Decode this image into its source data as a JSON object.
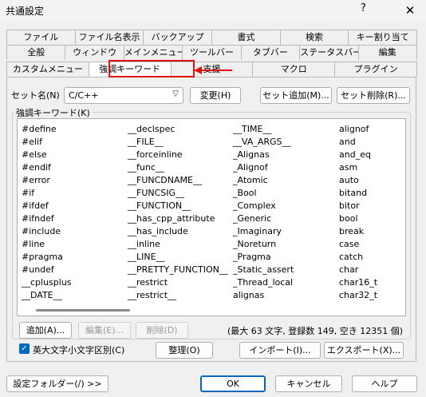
{
  "window": {
    "title": "共通設定",
    "help_glyph": "?",
    "close_glyph": "✕"
  },
  "tabs": {
    "row1": [
      "ファイル",
      "ファイル名表示",
      "バックアップ",
      "書式",
      "検索",
      "キー割り当て"
    ],
    "row2": [
      "全般",
      "ウィンドウ",
      "メインメニュー",
      "ツールバー",
      "タブバー",
      "ステータスバー",
      "編集"
    ],
    "row3": [
      "カスタムメニュー",
      "強調キーワード",
      "支援",
      "マクロ",
      "プラグイン"
    ],
    "active": "強調キーワード"
  },
  "set": {
    "label": "セット名(N)",
    "value": "C/C++",
    "change_button": "変更(H)",
    "add_button": "セット追加(M)...",
    "delete_button": "セット削除(R)..."
  },
  "keywords": {
    "group_title": "強調キーワード(K)",
    "columns": [
      [
        "#define",
        "#elif",
        "#else",
        "#endif",
        "#error",
        "#if",
        "#ifdef",
        "#ifndef",
        "#include",
        "#line",
        "#pragma",
        "#undef",
        "__cplusplus",
        "__DATE__"
      ],
      [
        "__declspec",
        "__FILE__",
        "__forceinline",
        "__func__",
        "__FUNCDNAME__",
        "__FUNCSIG__",
        "__FUNCTION__",
        "__has_cpp_attribute",
        "__has_include",
        "__inline",
        "__LINE__",
        "__PRETTY_FUNCTION__",
        "__restrict",
        "__restrict__"
      ],
      [
        "__TIME__",
        "__VA_ARGS__",
        "_Alignas",
        "_Alignof",
        "_Atomic",
        "_Bool",
        "_Complex",
        "_Generic",
        "_Imaginary",
        "_Noreturn",
        "_Pragma",
        "_Static_assert",
        "_Thread_local",
        "alignas"
      ],
      [
        "alignof",
        "and",
        "and_eq",
        "asm",
        "auto",
        "bitand",
        "bitor",
        "bool",
        "break",
        "case",
        "catch",
        "char",
        "char16_t",
        "char32_t"
      ]
    ],
    "add_button": "追加(A)...",
    "edit_button": "編集(E)...",
    "delete_button": "削除(D)",
    "stats": "(最大 63 文字, 登録数 149, 空き 12351 個)"
  },
  "options": {
    "case_checkbox_label": "英大文字小文字区別(C)",
    "case_checked": true,
    "organize_button": "整理(O)",
    "import_button": "インポート(I)...",
    "export_button": "エクスポート(X)..."
  },
  "footer": {
    "settings_folder_button": "設定フォルダー(/) >>",
    "ok_button": "OK",
    "cancel_button": "キャンセル",
    "help_button": "ヘルプ"
  },
  "colors": {
    "highlight": "#e01010",
    "accent": "#0067c0"
  }
}
